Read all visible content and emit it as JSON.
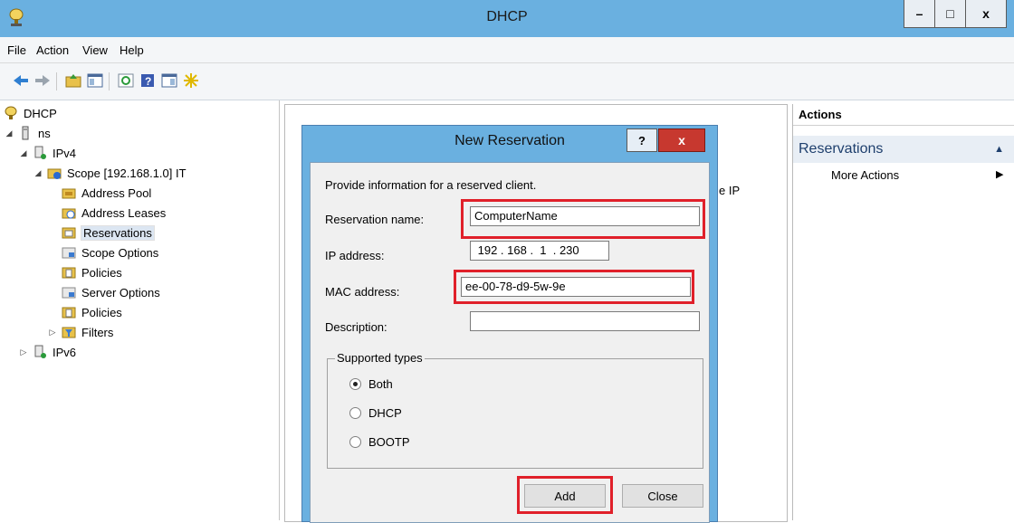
{
  "window": {
    "title": "DHCP",
    "minimize": "–",
    "maximize": "□",
    "close": "x"
  },
  "menu": [
    "File",
    "Action",
    "View",
    "Help"
  ],
  "tree": {
    "root": "DHCP",
    "server": "ns",
    "ipv4": "IPv4",
    "scope": "Scope [192.168.1.0] IT",
    "scope_children": [
      "Address Pool",
      "Address Leases",
      "Reservations",
      "Scope Options",
      "Policies"
    ],
    "ipv4_children": [
      "Server Options",
      "Policies",
      "Filters"
    ],
    "ipv6": "IPv6"
  },
  "center": {
    "clipped_text": "e IP"
  },
  "actions": {
    "title": "Actions",
    "section": "Reservations",
    "more": "More Actions"
  },
  "dialog": {
    "title": "New Reservation",
    "help": "?",
    "close": "x",
    "intro": "Provide information for a reserved client.",
    "reservation_name_label": "Reservation name:",
    "reservation_name_value": "ComputerName",
    "ip_label": "IP address:",
    "ip_value": " 192 . 168 .  1  . 230",
    "mac_label": "MAC address:",
    "mac_value": "ee-00-78-d9-5w-9e",
    "description_label": "Description:",
    "description_value": "",
    "supported_types_label": "Supported types",
    "types": [
      "Both",
      "DHCP",
      "BOOTP"
    ],
    "selected_type": "Both",
    "add_button": "Add",
    "close_button": "Close"
  },
  "colors": {
    "titlebar": "#6ab0e0",
    "highlight": "#e0202a",
    "dialog_close": "#c7382f"
  }
}
